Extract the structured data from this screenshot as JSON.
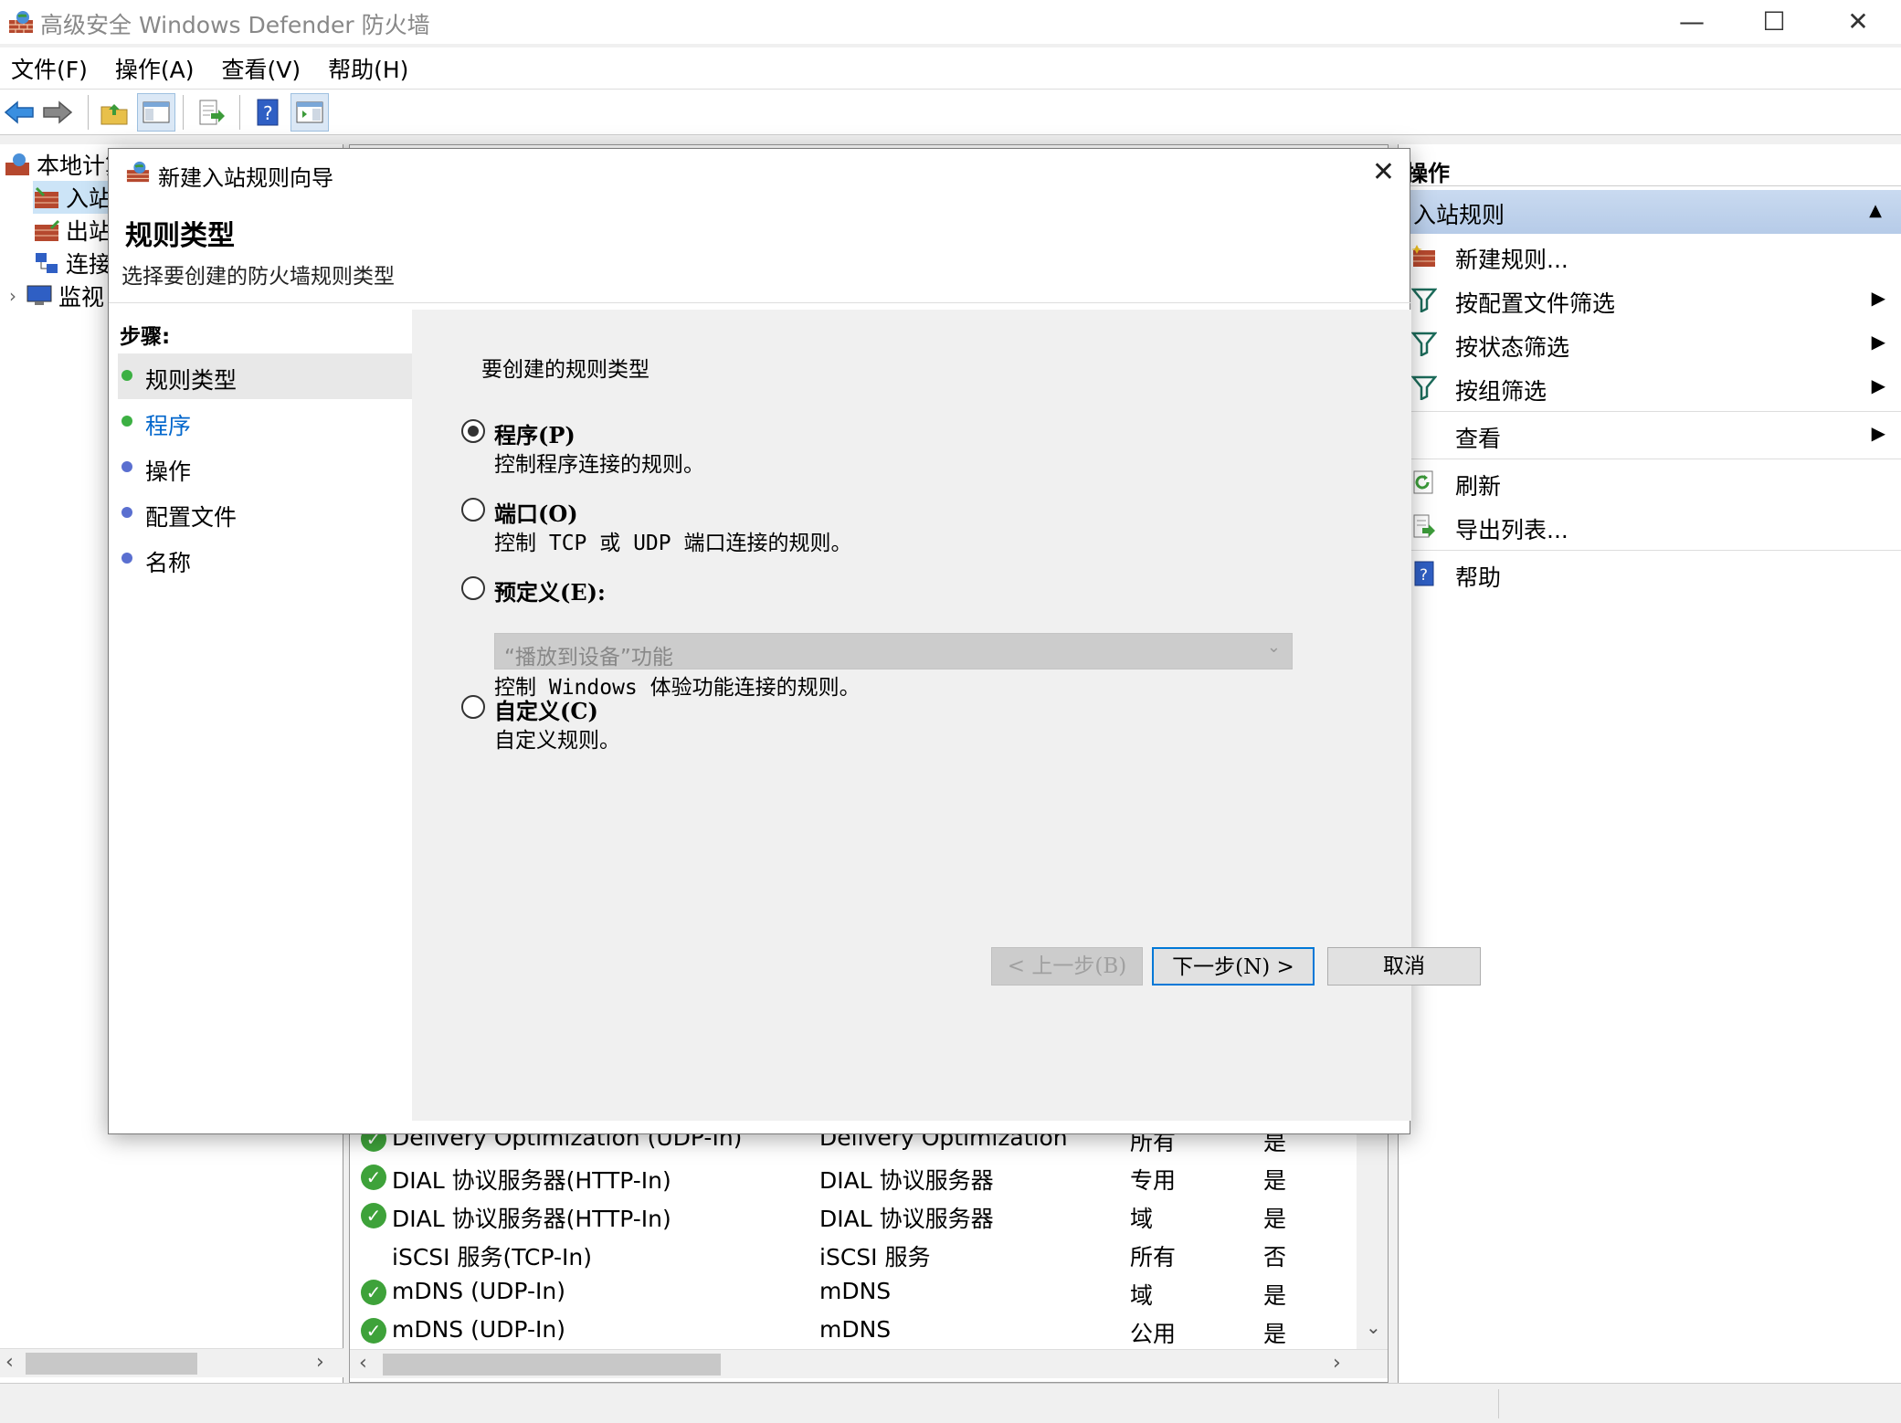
{
  "window": {
    "title": "高级安全 Windows Defender 防火墙",
    "minimize": "—",
    "maximize": "☐",
    "close": "✕"
  },
  "menu": [
    "文件(F)",
    "操作(A)",
    "查看(V)",
    "帮助(H)"
  ],
  "toolbar_icons": [
    "back-arrow-icon",
    "forward-arrow-icon",
    "up-folder-icon",
    "show-hide-tree-icon",
    "export-list-icon",
    "help-icon",
    "show-hide-action-pane-icon"
  ],
  "tree": {
    "root": "本地计算机",
    "items": [
      "入站规则",
      "出站规则",
      "连接安全规则",
      "监视"
    ]
  },
  "list": {
    "rows": [
      {
        "name": "Delivery Optimization (UDP-In)",
        "group": "Delivery Optimization",
        "profile": "所有",
        "enabled": "是",
        "ok": true
      },
      {
        "name": "DIAL 协议服务器(HTTP-In)",
        "group": "DIAL 协议服务器",
        "profile": "专用",
        "enabled": "是",
        "ok": true
      },
      {
        "name": "DIAL 协议服务器(HTTP-In)",
        "group": "DIAL 协议服务器",
        "profile": "域",
        "enabled": "是",
        "ok": true
      },
      {
        "name": "iSCSI 服务(TCP-In)",
        "group": "iSCSI 服务",
        "profile": "所有",
        "enabled": "否",
        "ok": false
      },
      {
        "name": "mDNS (UDP-In)",
        "group": "mDNS",
        "profile": "域",
        "enabled": "是",
        "ok": true
      },
      {
        "name": "mDNS (UDP-In)",
        "group": "mDNS",
        "profile": "公用",
        "enabled": "是",
        "ok": true
      }
    ]
  },
  "actions": {
    "header": "操作",
    "section": "入站规则",
    "items": [
      {
        "label": "新建规则...",
        "icon": "new-rule-icon",
        "submenu": false
      },
      {
        "label": "按配置文件筛选",
        "icon": "filter-icon",
        "submenu": true
      },
      {
        "label": "按状态筛选",
        "icon": "filter-icon",
        "submenu": true
      },
      {
        "label": "按组筛选",
        "icon": "filter-icon",
        "submenu": true
      },
      {
        "label": "查看",
        "icon": "",
        "submenu": true
      },
      {
        "label": "刷新",
        "icon": "refresh-icon",
        "submenu": false
      },
      {
        "label": "导出列表...",
        "icon": "export-icon",
        "submenu": false
      },
      {
        "label": "帮助",
        "icon": "help-icon",
        "submenu": false
      }
    ]
  },
  "dialog": {
    "title": "新建入站规则向导",
    "heading": "规则类型",
    "subtitle": "选择要创建的防火墙规则类型",
    "steps_title": "步骤:",
    "steps": [
      {
        "label": "规则类型",
        "state": "current",
        "color": "#3cb043"
      },
      {
        "label": "程序",
        "state": "link",
        "color": "#3cb043"
      },
      {
        "label": "操作",
        "state": "pending",
        "color": "#5a6fd0"
      },
      {
        "label": "配置文件",
        "state": "pending",
        "color": "#5a6fd0"
      },
      {
        "label": "名称",
        "state": "pending",
        "color": "#5a6fd0"
      }
    ],
    "question": "要创建的规则类型",
    "options": [
      {
        "label": "程序(P)",
        "desc": "控制程序连接的规则。",
        "checked": true
      },
      {
        "label": "端口(O)",
        "desc": "控制 TCP 或 UDP 端口连接的规则。",
        "checked": false
      },
      {
        "label": "预定义(E):",
        "desc": "控制 Windows 体验功能连接的规则。",
        "checked": false
      },
      {
        "label": "自定义(C)",
        "desc": "自定义规则。",
        "checked": false
      }
    ],
    "predefined_value": "“播放到设备”功能",
    "buttons": {
      "back": "< 上一步(B)",
      "next": "下一步(N) >",
      "cancel": "取消"
    }
  }
}
